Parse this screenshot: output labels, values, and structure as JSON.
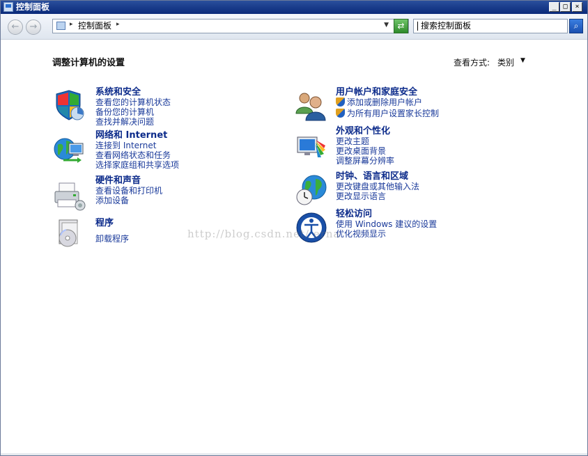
{
  "window": {
    "title": "控制面板"
  },
  "address": {
    "crumb": "控制面板"
  },
  "search": {
    "placeholder": "搜索控制面板"
  },
  "heading": "调整计算机的设置",
  "view_by": {
    "label": "查看方式:",
    "value": "类别"
  },
  "categories_left": [
    {
      "title": "系统和安全",
      "links": [
        "查看您的计算机状态",
        "备份您的计算机",
        "查找并解决问题"
      ]
    },
    {
      "title": "网络和 Internet",
      "links": [
        "连接到 Internet",
        "查看网络状态和任务",
        "选择家庭组和共享选项"
      ]
    },
    {
      "title": "硬件和声音",
      "links": [
        "查看设备和打印机",
        "添加设备"
      ]
    },
    {
      "title": "程序",
      "links": [
        "卸载程序"
      ]
    }
  ],
  "categories_right": [
    {
      "title": "用户帐户和家庭安全",
      "links": [
        "添加或删除用户帐户",
        "为所有用户设置家长控制"
      ]
    },
    {
      "title": "外观和个性化",
      "links": [
        "更改主题",
        "更改桌面背景",
        "调整屏幕分辨率"
      ]
    },
    {
      "title": "时钟、语言和区域",
      "links": [
        "更改键盘或其他输入法",
        "更改显示语言"
      ]
    },
    {
      "title": "轻松访问",
      "links": [
        "使用 Windows 建议的设置",
        "优化视频显示"
      ]
    }
  ],
  "icons": [
    "security-shield-icon",
    "network-globe-icon",
    "printer-icon",
    "programs-disc-icon",
    "users-icon",
    "display-colors-icon",
    "clock-globe-icon",
    "ease-of-access-icon"
  ],
  "watermark": "http://blog.csdn.net/        erna"
}
